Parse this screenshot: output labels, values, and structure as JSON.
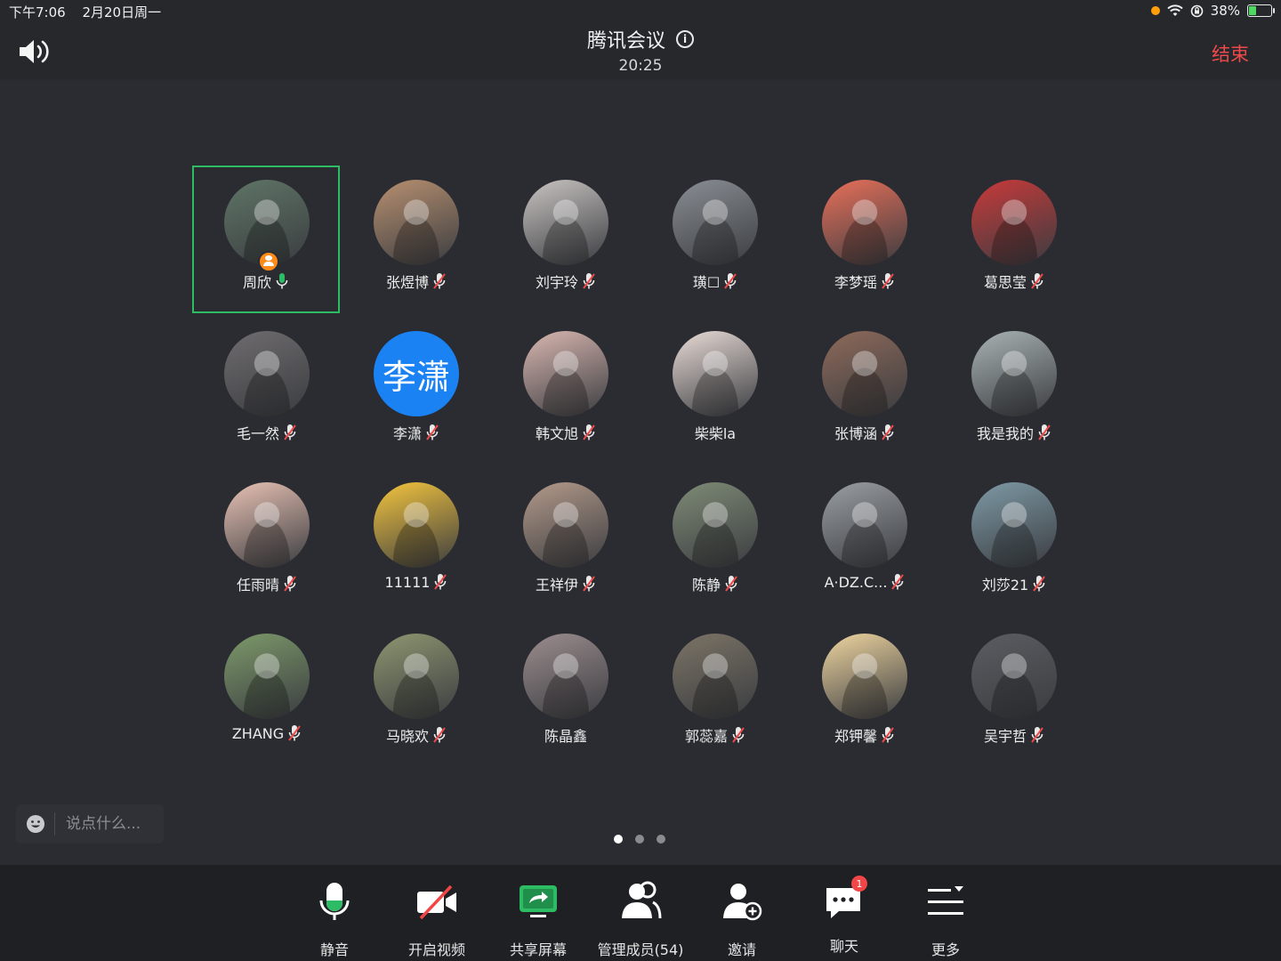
{
  "status_bar": {
    "time": "下午7:06",
    "date": "2月20日周一",
    "battery": "38%",
    "battery_level": 0.38
  },
  "header": {
    "title": "腾讯会议",
    "timer": "20:25",
    "end_label": "结束"
  },
  "participants": [
    {
      "name": "周欣",
      "mic": "on",
      "host": true,
      "active": true,
      "avatar_color": "#5f7566"
    },
    {
      "name": "张煜博",
      "mic": "muted",
      "avatar_color": "#b89070"
    },
    {
      "name": "刘宇玲",
      "mic": "muted",
      "avatar_color": "#c9c4c2"
    },
    {
      "name": "璜☐",
      "mic": "muted",
      "avatar_color": "#8a8f95"
    },
    {
      "name": "李梦瑶",
      "mic": "muted",
      "avatar_color": "#e9705a"
    },
    {
      "name": "葛思莹",
      "mic": "muted",
      "avatar_color": "#c83a3a"
    },
    {
      "name": "毛一然",
      "mic": "muted",
      "avatar_color": "#6f6c6e"
    },
    {
      "name": "李潇",
      "mic": "muted",
      "avatar_text": "李潇",
      "avatar_color": "#1b82f4"
    },
    {
      "name": "韩文旭",
      "mic": "muted",
      "avatar_color": "#d9b7b0"
    },
    {
      "name": "柴柴la",
      "mic": "none",
      "avatar_color": "#e9dcd7"
    },
    {
      "name": "张博涵",
      "mic": "muted",
      "avatar_color": "#8e6a5a"
    },
    {
      "name": "我是我的",
      "mic": "muted",
      "avatar_color": "#a9b3b4"
    },
    {
      "name": "任雨晴",
      "mic": "muted",
      "avatar_color": "#e9c2b4"
    },
    {
      "name": "11111",
      "mic": "muted",
      "avatar_color": "#f4c53e"
    },
    {
      "name": "王祥伊",
      "mic": "muted",
      "avatar_color": "#b49a8a"
    },
    {
      "name": "陈静",
      "mic": "muted",
      "avatar_color": "#7f8b76"
    },
    {
      "name": "A·DZ.C...",
      "mic": "muted",
      "avatar_color": "#9a9fa4"
    },
    {
      "name": "刘莎21",
      "mic": "muted",
      "avatar_color": "#7e9aa6"
    },
    {
      "name": "ZHANG",
      "mic": "muted",
      "avatar_color": "#7d9a6a"
    },
    {
      "name": "马晓欢",
      "mic": "muted",
      "avatar_color": "#8f9670"
    },
    {
      "name": "陈晶鑫",
      "mic": "none",
      "avatar_color": "#9c8d8f"
    },
    {
      "name": "郭蕊嘉",
      "mic": "muted",
      "avatar_color": "#7c7466"
    },
    {
      "name": "郑钾馨",
      "mic": "muted",
      "avatar_color": "#f0d6a0"
    },
    {
      "name": "吴宇哲",
      "mic": "muted",
      "avatar_color": "#5b5d62"
    }
  ],
  "chat": {
    "placeholder": "说点什么..."
  },
  "pager": {
    "pages": 3,
    "current": 1
  },
  "toolbar": {
    "mute": "静音",
    "video": "开启视频",
    "share": "共享屏幕",
    "members": "管理成员(54)",
    "invite": "邀请",
    "chat": "聊天",
    "chat_badge": "1",
    "more": "更多"
  },
  "colors": {
    "accent_green": "#2dbb63",
    "end_red": "#ef4a4a",
    "badge_red": "#f34646",
    "host_orange": "#ff8c1a"
  }
}
